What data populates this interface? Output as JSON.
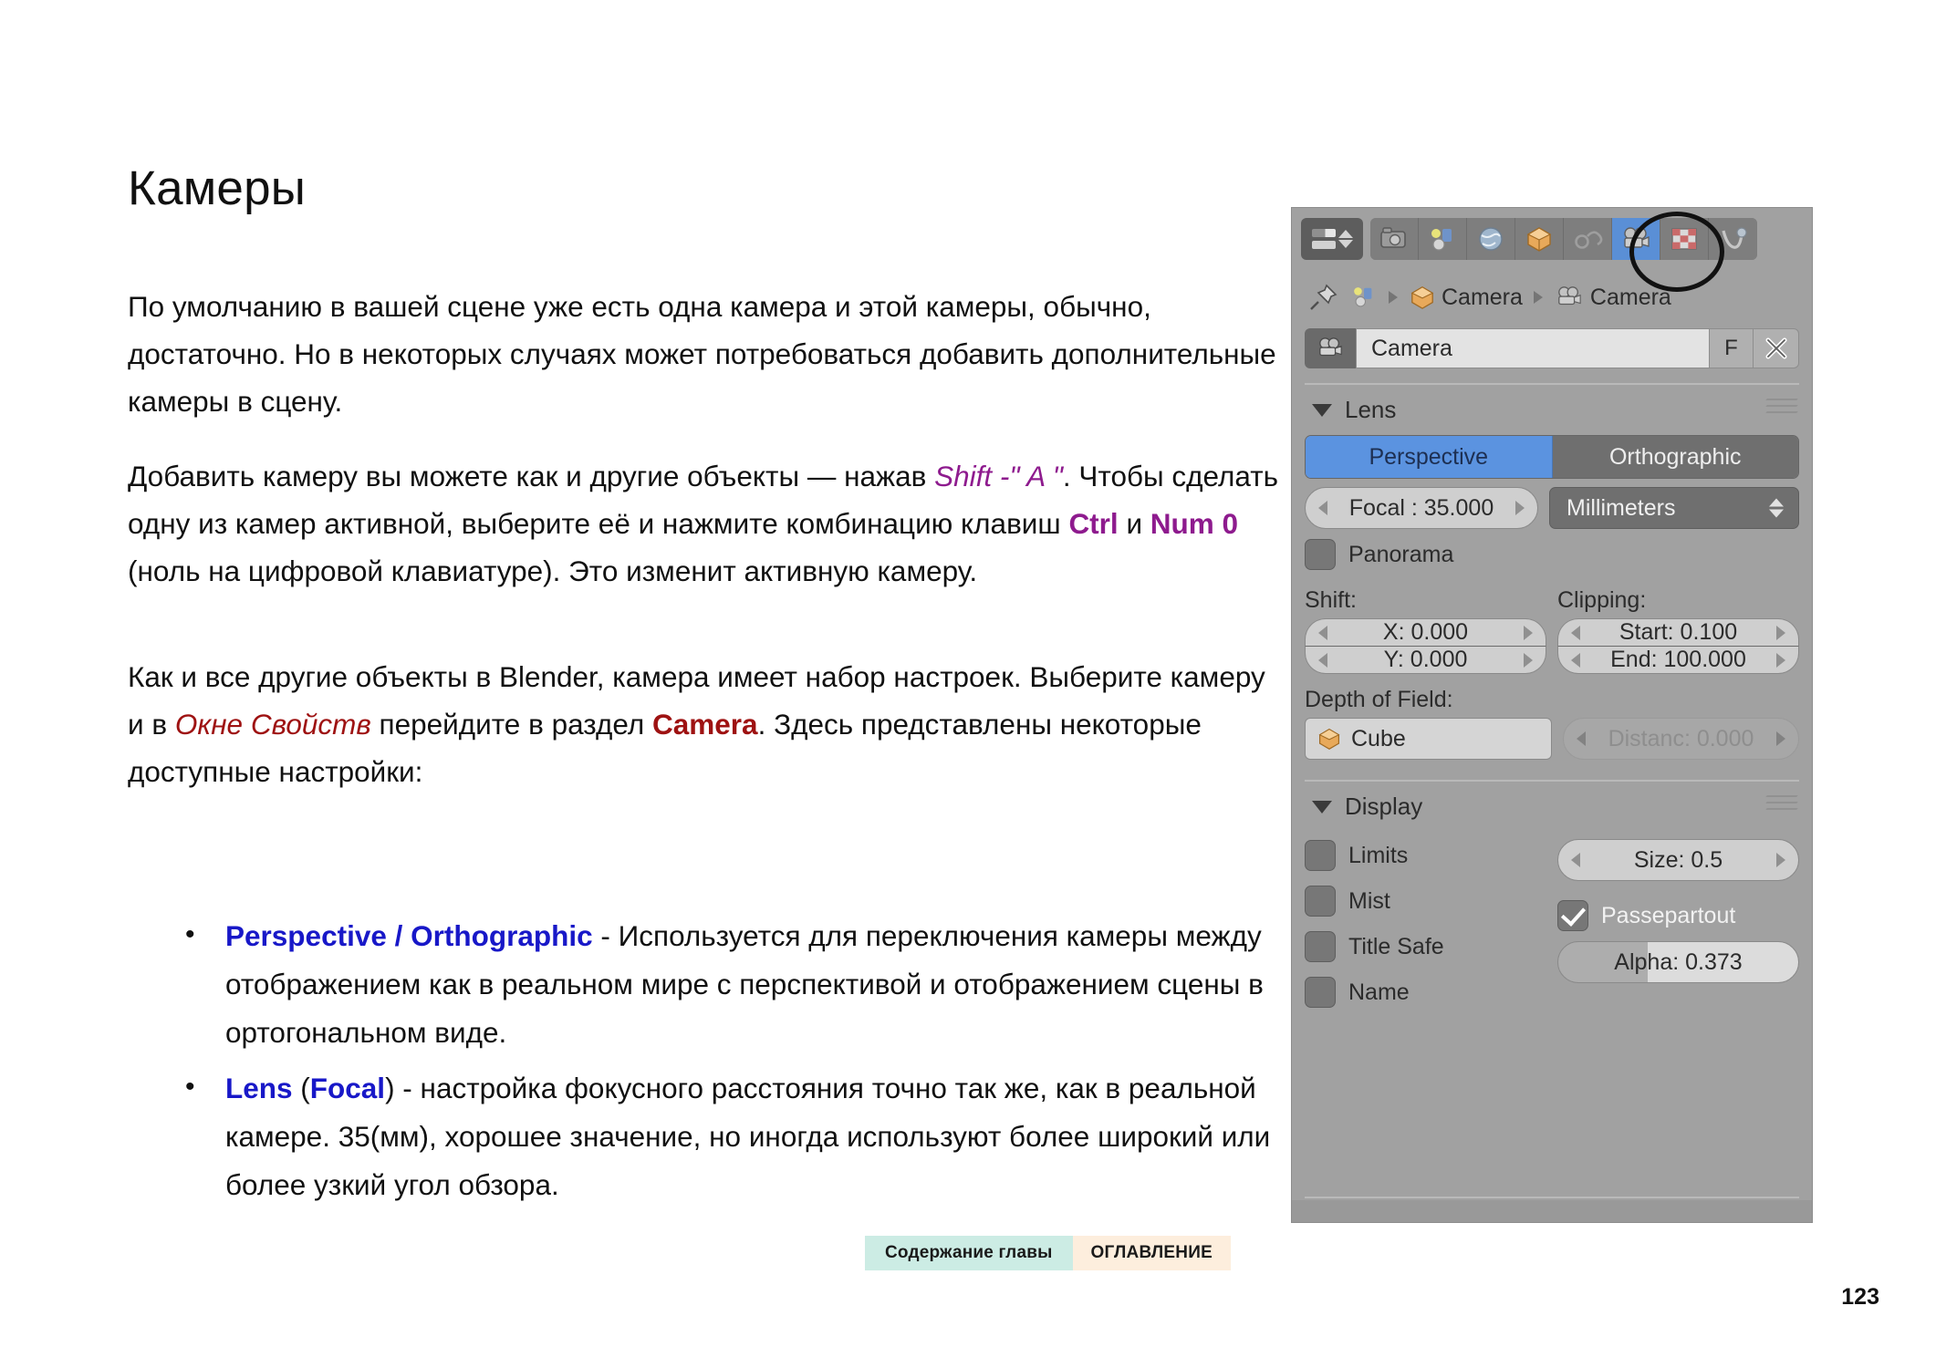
{
  "document": {
    "title": "Камеры",
    "page_number": "123",
    "paragraphs": [
      {
        "id": "p1",
        "runs": [
          {
            "text": "По умолчанию в вашей сцене уже есть одна камера и этой камеры, обычно, достаточно. Но в некоторых случаях может потребоваться добавить дополнительные камеры в сцену.",
            "style": "normal"
          }
        ]
      },
      {
        "id": "p2",
        "runs": [
          {
            "text": "Добавить камеру вы можете как и другие объекты — нажав ",
            "style": "normal"
          },
          {
            "text": "Shift -\" A \"",
            "style": "purple-italic"
          },
          {
            "text": ". Чтобы сделать одну из камер активной, выберите её и нажмите комбинацию клавиш ",
            "style": "normal"
          },
          {
            "text": "Ctrl",
            "style": "purple-bold"
          },
          {
            "text": " и ",
            "style": "normal"
          },
          {
            "text": "Num 0",
            "style": "purple-bold"
          },
          {
            "text": " (ноль на цифровой клавиатуре). Это изменит активную камеру.",
            "style": "normal"
          }
        ]
      },
      {
        "id": "p3",
        "runs": [
          {
            "text": "Как и все другие объекты в Blender, камера имеет набор настроек. Выберите камеру и в ",
            "style": "normal"
          },
          {
            "text": "Окне Свойств",
            "style": "red-italic"
          },
          {
            "text": " перейдите в раздел ",
            "style": "normal"
          },
          {
            "text": "Camera",
            "style": "red-bold"
          },
          {
            "text": ". Здесь представлены некоторые доступные настройки:",
            "style": "normal"
          }
        ]
      }
    ],
    "bullets": [
      {
        "runs": [
          {
            "text": "Perspective / Orthographic",
            "style": "blue-bold"
          },
          {
            "text": " - Используется для переключения камеры между отображением как в реальном мире с перспективой и отображением сцены в ортогональном виде.",
            "style": "normal"
          }
        ]
      },
      {
        "runs": [
          {
            "text": "Lens",
            "style": "blue-bold"
          },
          {
            "text": " (",
            "style": "normal"
          },
          {
            "text": "Focal",
            "style": "blue-bold"
          },
          {
            "text": ") - настройка фокусного расстояния точно так же, как в реальной камере. 35(мм), хорошее значение, но иногда используют более широкий или более узкий угол обзора.",
            "style": "normal"
          }
        ]
      }
    ]
  },
  "footer": {
    "chapter_button": "Содержание главы",
    "toc_button": "ОГЛАВЛЕНИЕ",
    "chapter_bg": "#ccece4",
    "toc_bg": "#fdeedd"
  },
  "blender_panel": {
    "editor_type_label": "properties-editor",
    "tabs": [
      {
        "name": "render",
        "icon": "camera-back-icon",
        "active": false
      },
      {
        "name": "scene",
        "icon": "scene-icon",
        "active": false
      },
      {
        "name": "world",
        "icon": "world-globe-icon",
        "active": false
      },
      {
        "name": "object",
        "icon": "cube-icon",
        "active": false
      },
      {
        "name": "constraints",
        "icon": "chain-link-icon",
        "active": false
      },
      {
        "name": "object-data",
        "icon": "movie-camera-icon",
        "active": true
      },
      {
        "name": "texture",
        "icon": "checker-icon",
        "active": false
      },
      {
        "name": "physics",
        "icon": "physics-icon",
        "active": false
      }
    ],
    "breadcrumb": {
      "pin_icon": "pin-icon",
      "scene_icon": "scene-icon",
      "items": [
        {
          "icon": "cube-icon",
          "label": "Camera"
        },
        {
          "icon": "movie-camera-icon",
          "label": "Camera"
        }
      ]
    },
    "datablock": {
      "icon": "movie-camera-icon",
      "name": "Camera",
      "fake_user_label": "F",
      "unlink_icon": "x-close-icon"
    },
    "lens_section": {
      "title": "Lens",
      "type_toggle": {
        "options": [
          "Perspective",
          "Orthographic"
        ],
        "selected": "Perspective",
        "selected_color": "#5b93e0"
      },
      "focal": "Focal : 35.000",
      "unit": "Millimeters",
      "panorama": {
        "label": "Panorama",
        "checked": false
      },
      "shift": {
        "label": "Shift:",
        "x": "X: 0.000",
        "y": "Y: 0.000"
      },
      "clipping": {
        "label": "Clipping:",
        "start": "Start: 0.100",
        "end": "End: 100.000"
      },
      "depth_of_field": {
        "label": "Depth of Field:",
        "focus_object": "Cube",
        "focus_object_icon": "cube-icon",
        "distance": "Distanc: 0.000",
        "distance_enabled": false
      }
    },
    "display_section": {
      "title": "Display",
      "checkboxes": [
        {
          "label": "Limits",
          "checked": false
        },
        {
          "label": "Mist",
          "checked": false
        },
        {
          "label": "Title Safe",
          "checked": false
        },
        {
          "label": "Name",
          "checked": false
        }
      ],
      "size": "Size: 0.5",
      "passepartout": {
        "label": "Passepartout",
        "checked": true
      },
      "alpha": {
        "label": "Alpha: 0.373",
        "fill_percent": 37.3
      }
    }
  }
}
